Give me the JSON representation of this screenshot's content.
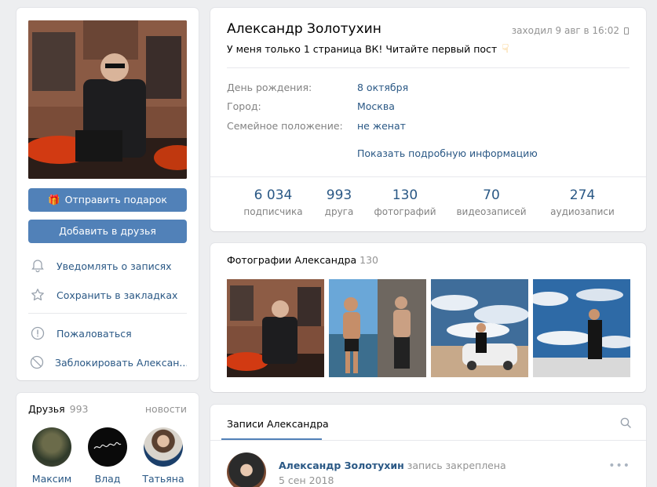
{
  "left": {
    "gift_button": "Отправить подарок",
    "add_friend_button": "Добавить в друзья",
    "menu": [
      {
        "label": "Уведомлять о записях",
        "icon": "bell-icon"
      },
      {
        "label": "Сохранить в закладках",
        "icon": "star-icon"
      },
      {
        "label": "Пожаловаться",
        "icon": "report-icon"
      },
      {
        "label": "Заблокировать Алексан...",
        "icon": "block-icon"
      }
    ]
  },
  "friends": {
    "title": "Друзья",
    "count": "993",
    "news_link": "новости",
    "items": [
      {
        "name": "Максим"
      },
      {
        "name": "Влад"
      },
      {
        "name": "Татьяна"
      }
    ]
  },
  "profile": {
    "name": "Александр Золотухин",
    "last_seen": "заходил 9 авг в 16:02",
    "status": "У меня только 1 страница ВК! Читайте первый пост",
    "info": [
      {
        "label": "День рождения:",
        "value": "8 октября"
      },
      {
        "label": "Город:",
        "value": "Москва"
      },
      {
        "label": "Семейное положение:",
        "value": "не женат"
      }
    ],
    "more_link": "Показать подробную информацию",
    "counters": [
      {
        "num": "6 034",
        "label": "подписчика"
      },
      {
        "num": "993",
        "label": "друга"
      },
      {
        "num": "130",
        "label": "фотографий"
      },
      {
        "num": "70",
        "label": "видеозаписей"
      },
      {
        "num": "274",
        "label": "аудиозаписи"
      }
    ]
  },
  "photos": {
    "title": "Фотографии Александра",
    "count": "130"
  },
  "wall": {
    "tab": "Записи Александра",
    "post": {
      "author": "Александр Золотухин",
      "pinned": "запись закреплена",
      "date": "5 сен 2018",
      "menu": "•••"
    }
  },
  "colors": {
    "accent": "#5181b8",
    "link": "#2a5885",
    "muted": "#939393",
    "background": "#edeef0"
  }
}
